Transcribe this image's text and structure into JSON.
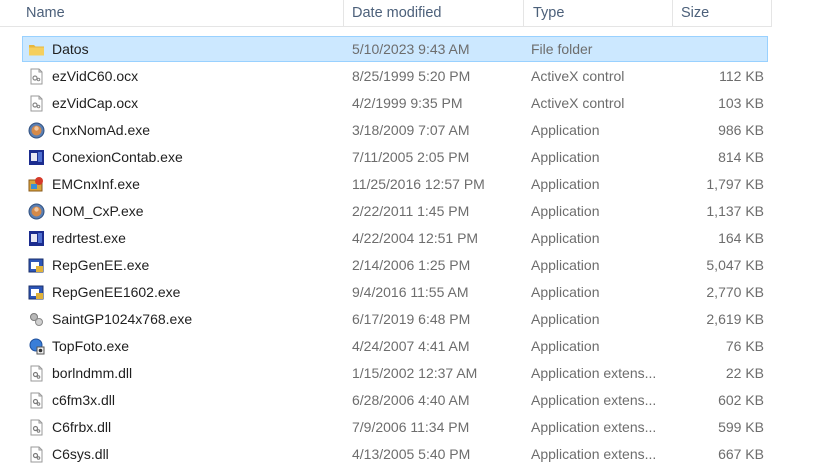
{
  "columns": {
    "name": "Name",
    "date": "Date modified",
    "type": "Type",
    "size": "Size"
  },
  "files": [
    {
      "name": "Datos",
      "date": "5/10/2023 9:43 AM",
      "type": "File folder",
      "size": "",
      "icon": "folder-icon",
      "selected": true
    },
    {
      "name": "ezVidC60.ocx",
      "date": "8/25/1999 5:20 PM",
      "type": "ActiveX control",
      "size": "112 KB",
      "icon": "activex-file-icon"
    },
    {
      "name": "ezVidCap.ocx",
      "date": "4/2/1999 9:35 PM",
      "type": "ActiveX control",
      "size": "103 KB",
      "icon": "activex-file-icon"
    },
    {
      "name": "CnxNomAd.exe",
      "date": "3/18/2009 7:07 AM",
      "type": "Application",
      "size": "986 KB",
      "icon": "round-app-icon"
    },
    {
      "name": "ConexionContab.exe",
      "date": "7/11/2005 2:05 PM",
      "type": "Application",
      "size": "814 KB",
      "icon": "blue-app-icon"
    },
    {
      "name": "EMCnxInf.exe",
      "date": "11/25/2016 12:57 PM",
      "type": "Application",
      "size": "1,797 KB",
      "icon": "colorful-app-icon"
    },
    {
      "name": "NOM_CxP.exe",
      "date": "2/22/2011 1:45 PM",
      "type": "Application",
      "size": "1,137 KB",
      "icon": "round-app-icon"
    },
    {
      "name": "redrtest.exe",
      "date": "4/22/2004 12:51 PM",
      "type": "Application",
      "size": "164 KB",
      "icon": "blue-app-icon"
    },
    {
      "name": "RepGenEE.exe",
      "date": "2/14/2006 1:25 PM",
      "type": "Application",
      "size": "5,047 KB",
      "icon": "report-app-icon"
    },
    {
      "name": "RepGenEE1602.exe",
      "date": "9/4/2016 11:55 AM",
      "type": "Application",
      "size": "2,770 KB",
      "icon": "report-app-icon"
    },
    {
      "name": "SaintGP1024x768.exe",
      "date": "6/17/2019 6:48 PM",
      "type": "Application",
      "size": "2,619 KB",
      "icon": "gear-app-icon"
    },
    {
      "name": "TopFoto.exe",
      "date": "4/24/2007 4:41 AM",
      "type": "Application",
      "size": "76 KB",
      "icon": "photo-app-icon"
    },
    {
      "name": "borlndmm.dll",
      "date": "1/15/2002 12:37 AM",
      "type": "Application extens...",
      "size": "22 KB",
      "icon": "dll-file-icon"
    },
    {
      "name": "c6fm3x.dll",
      "date": "6/28/2006 4:40 AM",
      "type": "Application extens...",
      "size": "602 KB",
      "icon": "dll-file-icon"
    },
    {
      "name": "C6frbx.dll",
      "date": "7/9/2006 11:34 PM",
      "type": "Application extens...",
      "size": "599 KB",
      "icon": "dll-file-icon"
    },
    {
      "name": "C6sys.dll",
      "date": "4/13/2005 5:40 PM",
      "type": "Application extens...",
      "size": "667 KB",
      "icon": "dll-file-icon"
    }
  ]
}
